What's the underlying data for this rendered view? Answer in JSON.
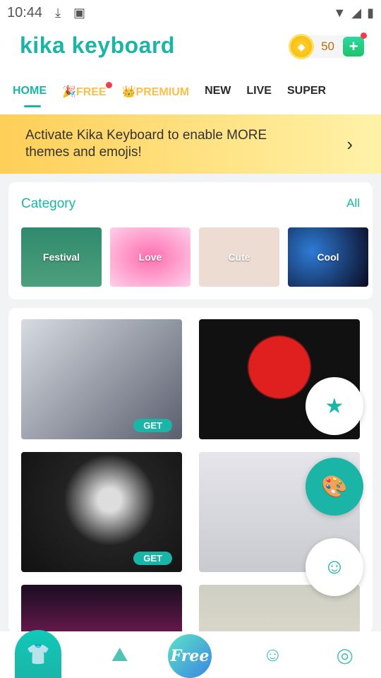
{
  "status": {
    "time": "10:44",
    "icons": [
      "download-icon",
      "keyboard-a-icon",
      "wifi-icon",
      "signal-icon",
      "battery-icon"
    ]
  },
  "header": {
    "logo": "kika keyboard",
    "coins": "50"
  },
  "tabs": [
    {
      "label": "HOME"
    },
    {
      "label": "🎉FREE"
    },
    {
      "label": "👑PREMIUM"
    },
    {
      "label": "NEW"
    },
    {
      "label": "LIVE"
    },
    {
      "label": "SUPER"
    }
  ],
  "banner": {
    "text": "Activate Kika Keyboard to enable MORE themes and emojis!"
  },
  "category": {
    "title": "Category",
    "all": "All",
    "items": [
      {
        "label": "Festival"
      },
      {
        "label": "Love"
      },
      {
        "label": "Cute"
      },
      {
        "label": "Cool"
      }
    ]
  },
  "themes": [
    {
      "get": "GET"
    },
    {
      "get": ""
    },
    {
      "get": "GET"
    },
    {
      "get": ""
    },
    {
      "get": ""
    },
    {
      "get": ""
    }
  ],
  "nav": {
    "free": "Free"
  },
  "colors": {
    "accent": "#1bb5a8",
    "banner": "#ffcf57",
    "badge": "#f33c4a"
  }
}
